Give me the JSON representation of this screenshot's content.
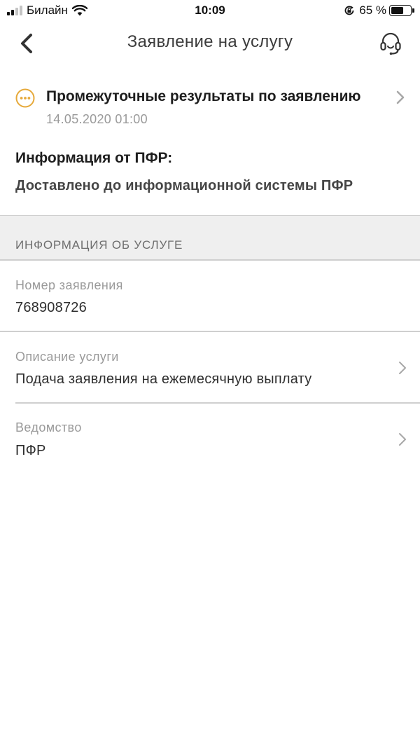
{
  "status_bar": {
    "carrier": "Билайн",
    "time": "10:09",
    "battery_percent": "65 %",
    "battery_level": 0.65,
    "icons": [
      "signal-icon",
      "wifi-icon",
      "rotation-lock-icon",
      "battery-icon"
    ]
  },
  "nav": {
    "title": "Заявление на услугу",
    "back_icon": "chevron-left-icon",
    "support_icon": "headset-icon"
  },
  "status": {
    "title": "Промежуточные результаты по заявлению",
    "date": "14.05.2020 01:00",
    "icon": "ellipsis-circle-icon",
    "accent_color": "#e6a93a"
  },
  "info": {
    "label": "Информация от ПФР:",
    "value": "Доставлено до информационной системы ПФР"
  },
  "section": {
    "title": "ИНФОРМАЦИЯ ОБ УСЛУГЕ"
  },
  "details": [
    {
      "label": "Номер заявления",
      "value": "768908726"
    },
    {
      "label": "Описание услуги",
      "value": "Подача заявления на ежемесячную выплату"
    },
    {
      "label": "Ведомство",
      "value": "ПФР"
    }
  ]
}
